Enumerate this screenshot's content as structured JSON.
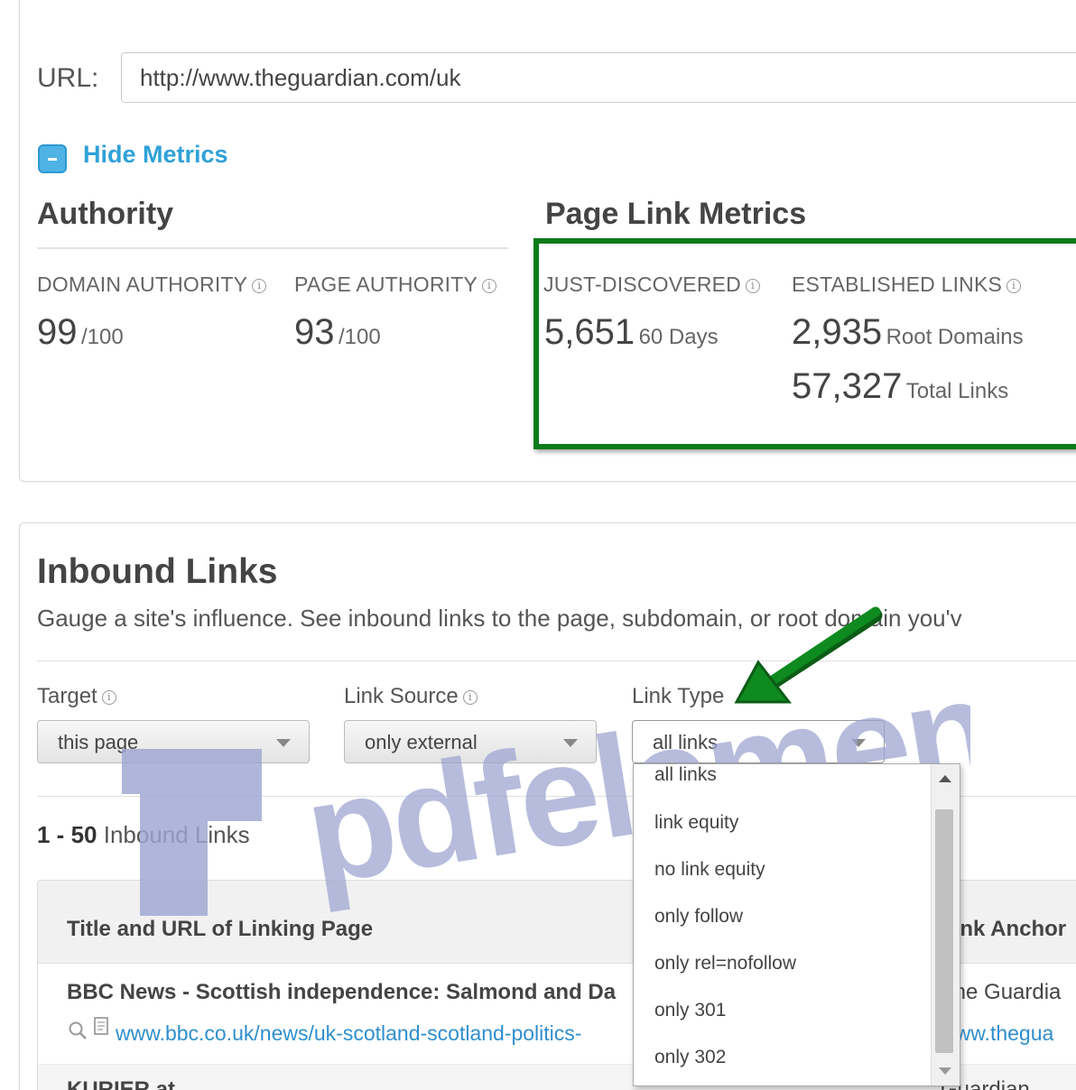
{
  "url": {
    "label": "URL:",
    "value": "http://www.theguardian.com/uk"
  },
  "metrics_toggle": {
    "label": "Hide Metrics"
  },
  "authority": {
    "heading": "Authority",
    "domain_label": "DOMAIN AUTHORITY",
    "domain_value": "99",
    "domain_unit": "/100",
    "page_label": "PAGE AUTHORITY",
    "page_value": "93",
    "page_unit": "/100"
  },
  "page_link_metrics": {
    "heading": "Page Link Metrics",
    "just_label": "JUST-DISCOVERED",
    "just_value": "5,651",
    "just_unit": "60 Days",
    "established_label": "ESTABLISHED LINKS",
    "root_value": "2,935",
    "root_unit": "Root Domains",
    "total_value": "57,327",
    "total_unit": "Total Links"
  },
  "inbound": {
    "heading": "Inbound Links",
    "description": "Gauge a site's influence. See inbound links to the page, subdomain, or root domain you'v",
    "filters": {
      "target_label": "Target",
      "target_value": "this page",
      "source_label": "Link Source",
      "source_value": "only external",
      "type_label": "Link Type",
      "type_value": "all links"
    },
    "count_range": "1 - 50",
    "count_label": " Inbound Links",
    "table": {
      "col_title": "Title and URL of Linking Page",
      "col_anchor": "Link Anchor",
      "rows": [
        {
          "title": "BBC News - Scottish independence: Salmond and Da",
          "url": "www.bbc.co.uk/news/uk-scotland-scotland-politics-",
          "anchor": "The Guardia",
          "anchor_url": "www.thegua"
        },
        {
          "title": "KURIER.at",
          "anchor": "Guardian"
        }
      ]
    }
  },
  "link_type_options": [
    "all links",
    "link equity",
    "no link equity",
    "only follow",
    "only rel=nofollow",
    "only 301",
    "only 302"
  ],
  "watermark": "pdfelement",
  "colors": {
    "accent": "#2fa1d8",
    "highlight_box": "#0c7b1a",
    "arrow": "#0e8a1f",
    "watermark": "#9fa6d2"
  }
}
